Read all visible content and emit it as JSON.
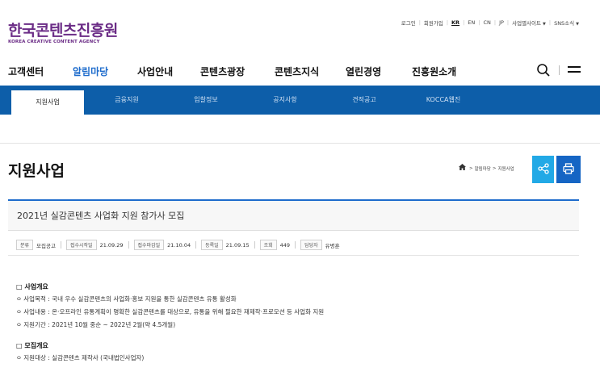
{
  "header": {
    "logo_ko": "한국콘텐츠진흥원",
    "logo_en": "KOREA CREATIVE CONTENT AGENCY",
    "utility": [
      "로그인",
      "회원가입",
      "KR",
      "EN",
      "CN",
      "JP",
      "사업별사이트",
      "SNS소식"
    ],
    "utility_active": "KR"
  },
  "gnb": {
    "items": [
      "고객센터",
      "알림마당",
      "사업안내",
      "콘텐츠광장",
      "콘텐츠지식",
      "열린경영",
      "진흥원소개"
    ],
    "active": "알림마당"
  },
  "subnav": {
    "items": [
      "지원사업",
      "금융지원",
      "입찰정보",
      "공지사항",
      "견적공고",
      "KOCCA웹진"
    ],
    "active": "지원사업"
  },
  "page": {
    "title": "지원사업",
    "breadcrumb": [
      "알림마당",
      "지원사업"
    ]
  },
  "post": {
    "title": "2021년 실감콘텐츠 사업화 지원 참가사 모집",
    "meta": [
      {
        "label": "분류",
        "value": "모집공고"
      },
      {
        "label": "접수시작일",
        "value": "21.09.29"
      },
      {
        "label": "접수마감일",
        "value": "21.10.04"
      },
      {
        "label": "등록일",
        "value": "21.09.15"
      },
      {
        "label": "조회",
        "value": "449"
      },
      {
        "label": "담당자",
        "value": "유병훈"
      }
    ]
  },
  "content": {
    "sections": [
      {
        "title": "□ 사업개요",
        "lines": [
          "ㅇ 사업목적 : 국내 우수 실감콘텐츠의 사업화·홍보 지원을 통한 실감콘텐츠 유통 활성화",
          "ㅇ 사업내용 : 온·오프라인 유통계획이 명확한 실감콘텐츠를 대상으로, 유통을 위해 필요한 재제작·프로모션 등 사업화 지원",
          "ㅇ 지원기간 : 2021년 10월 중순 ~ 2022년 2월(약 4.5개월)"
        ]
      },
      {
        "title": "□ 모집개요",
        "lines": [
          "ㅇ 지원대상 : 실감콘텐츠 제작사 (국내법인사업자)"
        ]
      }
    ]
  },
  "colors": {
    "brand": "#6b2c86",
    "primary": "#0d5ea9",
    "accent": "#1e6ccc",
    "share": "#22a9e6",
    "print": "#1565c4"
  },
  "icons": [
    "search-icon",
    "menu-icon",
    "home-icon",
    "share-icon",
    "print-icon"
  ]
}
